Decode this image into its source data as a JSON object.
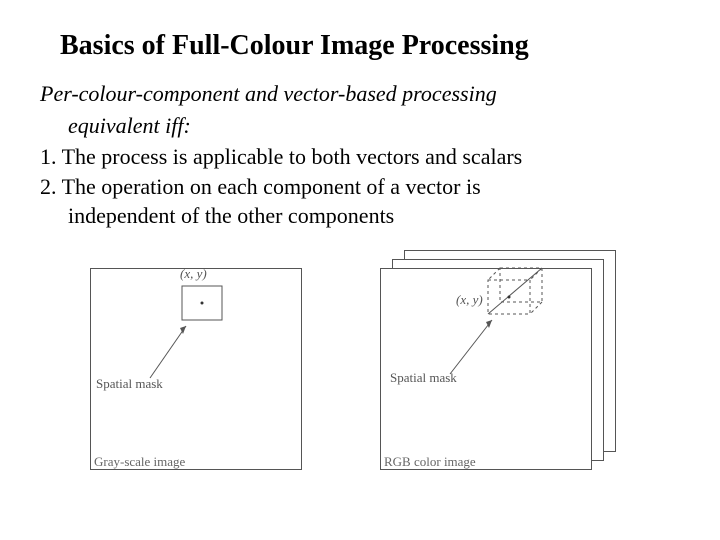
{
  "title": "Basics of Full-Colour Image Processing",
  "intro_line1": "Per-colour-component and vector-based processing",
  "intro_line2": "equivalent iff:",
  "item1": "1. The process is applicable to both vectors and scalars",
  "item2_line1": "2. The operation on each component of a vector is",
  "item2_line2": "independent of the other components",
  "fig1": {
    "xy": "(x, y)",
    "mask": "Spatial mask",
    "caption": "Gray-scale image"
  },
  "fig2": {
    "xy": "(x, y)",
    "mask": "Spatial mask",
    "caption": "RGB color image"
  }
}
